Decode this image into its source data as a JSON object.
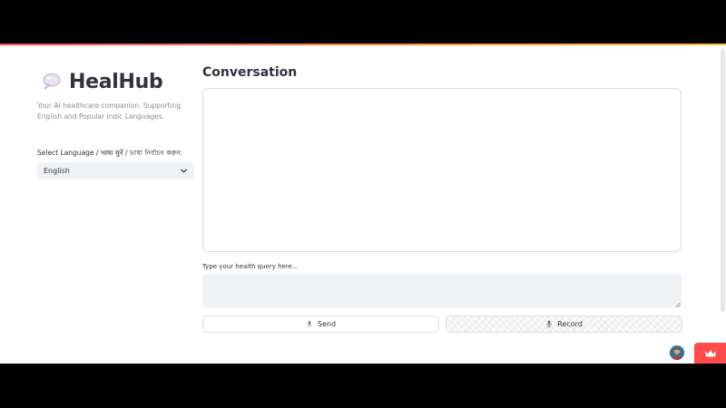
{
  "app": {
    "title": "HealHub",
    "tagline": "Your AI healthcare companion. Supporting English and Popular Indic Languages.",
    "brand_icon": "speech-bubble-icon",
    "accent_colors": [
      "#ff4b4b",
      "#ffbd45"
    ]
  },
  "sidebar": {
    "language_label": "Select Language / भाषा चुनें / ভাষা নির্বাচন করুন:",
    "language_select": {
      "selected": "English"
    }
  },
  "main": {
    "conversation_title": "Conversation",
    "query_label": "Type your health query here...",
    "query_value": "",
    "send_button": {
      "label": "Send",
      "icon": "send-icon"
    },
    "record_button": {
      "label": "Record",
      "icon": "microphone-icon"
    }
  },
  "footer": {
    "avatar_icon": "user-avatar-icon",
    "badge_icon": "crown-icon",
    "badge_color": "#ff4b4b"
  }
}
